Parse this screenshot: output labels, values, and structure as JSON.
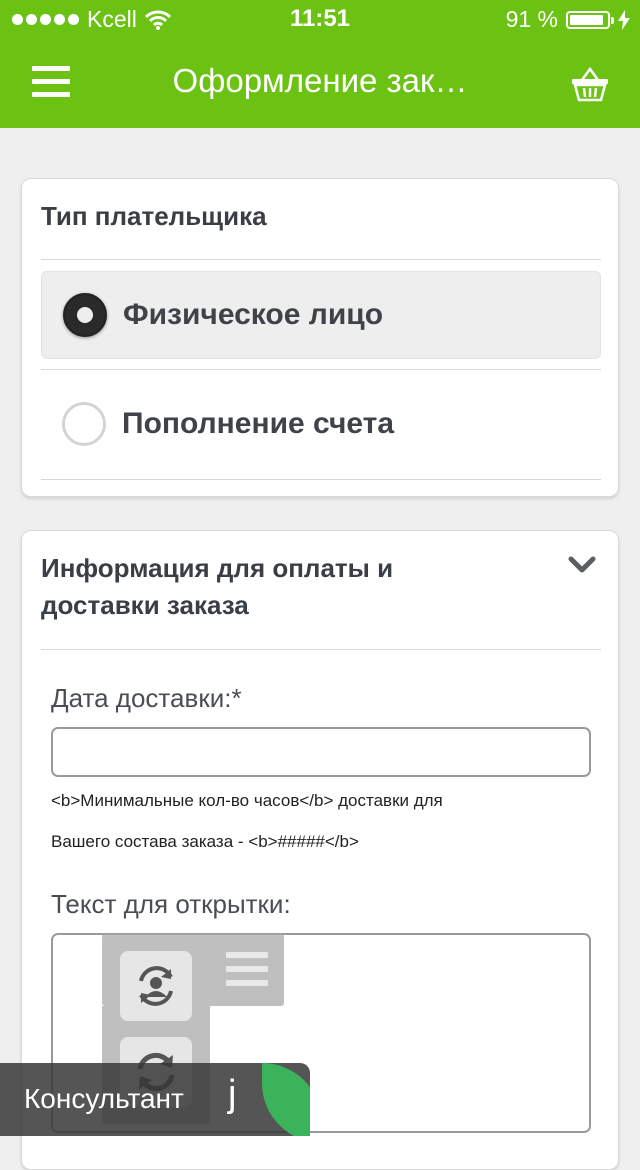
{
  "status_bar": {
    "carrier": "Kcell",
    "time": "11:51",
    "battery_text": "91 %",
    "battery_level": 0.91
  },
  "nav": {
    "title": "Оформление зак…"
  },
  "payer_card": {
    "heading": "Тип плательщика",
    "options": [
      {
        "label": "Физическое лицо",
        "selected": true
      },
      {
        "label": "Пополнение счета",
        "selected": false
      }
    ]
  },
  "info_card": {
    "heading_line1": "Информация для оплаты и",
    "heading_line2": "доставки заказа",
    "delivery_date_label": "Дата доставки:*",
    "delivery_date_value": "",
    "hint_line1": "<b>Минимальные кол-во часов</b> доставки для",
    "hint_line2": "Вашего состава заказа - <b>#####</b>",
    "card_text_label": "Текст для открытки:",
    "card_text_value": ""
  },
  "consultant": {
    "label": "Консультант",
    "logo_letter": "j"
  },
  "colors": {
    "brand_green": "#6cc212",
    "consult_leaf": "#3bb35a"
  }
}
